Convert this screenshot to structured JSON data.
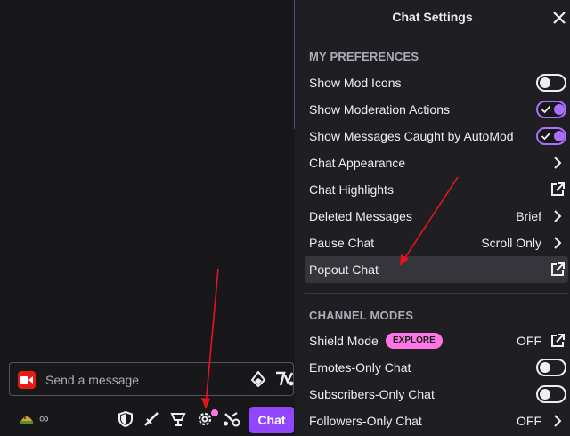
{
  "chat": {
    "input_placeholder": "Send a message",
    "points_value": "∞",
    "chat_button_label": "Chat"
  },
  "settings": {
    "title": "Chat Settings",
    "preferences_title": "MY PREFERENCES",
    "channel_modes_title": "CHANNEL MODES",
    "preferences": [
      {
        "label": "Show Mod Icons",
        "control": "toggle",
        "state": "off"
      },
      {
        "label": "Show Moderation Actions",
        "control": "toggle",
        "state": "on"
      },
      {
        "label": "Show Messages Caught by AutoMod",
        "control": "toggle",
        "state": "on"
      },
      {
        "label": "Chat Appearance",
        "control": "chevron"
      },
      {
        "label": "Chat Highlights",
        "control": "external"
      },
      {
        "label": "Deleted Messages",
        "control": "chevron",
        "value": "Brief"
      },
      {
        "label": "Pause Chat",
        "control": "chevron",
        "value": "Scroll Only"
      },
      {
        "label": "Popout Chat",
        "control": "external",
        "highlighted": true
      }
    ],
    "channel_modes": [
      {
        "label": "Shield Mode",
        "badge": "EXPLORE",
        "value": "OFF",
        "control": "external"
      },
      {
        "label": "Emotes-Only Chat",
        "control": "toggle",
        "state": "off"
      },
      {
        "label": "Subscribers-Only Chat",
        "control": "toggle",
        "state": "off"
      },
      {
        "label": "Followers-Only Chat",
        "control": "chevron",
        "value": "OFF"
      }
    ]
  },
  "colors": {
    "background": "#18181b",
    "panel": "#1f1f23",
    "accent": "#9147ff",
    "toggle_on": "#a970ff",
    "badge": "#ff75e6",
    "annotation_arrow": "#e8141b"
  }
}
